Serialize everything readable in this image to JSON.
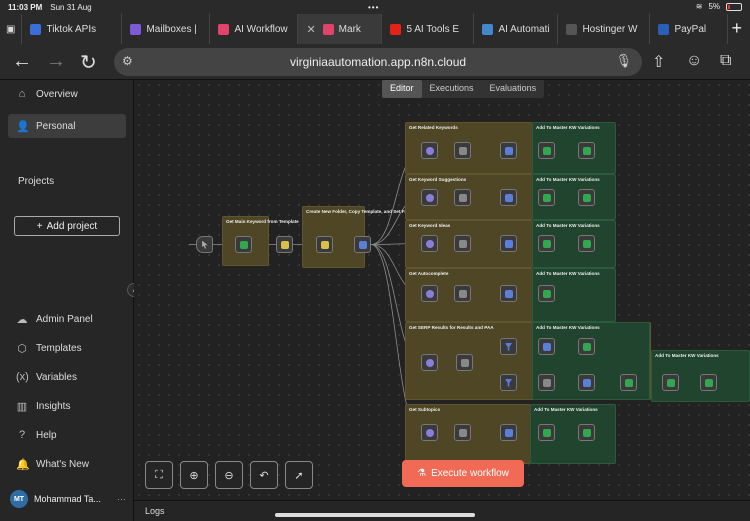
{
  "status": {
    "time": "11:03 PM",
    "date": "Sun 31 Aug",
    "battery": "5%"
  },
  "tabs": [
    {
      "label": "Tiktok APIs",
      "color": "#3b6ed8",
      "icon": "globe-icon"
    },
    {
      "label": "Mailboxes | ",
      "color": "#7b5bd6",
      "icon": "mailbox-icon"
    },
    {
      "label": "AI Workflow",
      "color": "#e1436b",
      "icon": "n8n-icon"
    },
    {
      "label": "Mark",
      "color": "#e1436b",
      "icon": "n8n-icon",
      "active": true
    },
    {
      "label": "5 AI Tools E",
      "color": "#e62117",
      "icon": "youtube-icon"
    },
    {
      "label": "AI Automati",
      "color": "#4488cc",
      "icon": "wave-icon"
    },
    {
      "label": "Hostinger W",
      "color": "#555555",
      "icon": "hostinger-icon"
    },
    {
      "label": "PayPal",
      "color": "#2a5fb8",
      "icon": "paypal-icon"
    }
  ],
  "address": {
    "url": "virginiaautomation.app.n8n.cloud"
  },
  "sidebar": {
    "top_items": [
      {
        "label": "Overview",
        "icon": "home-icon",
        "glyph": "⌂"
      },
      {
        "label": "Personal",
        "icon": "user-icon",
        "glyph": "👤",
        "active": true
      }
    ],
    "projects_heading": "Projects",
    "add_project": "Add project",
    "bottom_items": [
      {
        "label": "Admin Panel",
        "icon": "cloud-icon",
        "glyph": "☁"
      },
      {
        "label": "Templates",
        "icon": "box-icon",
        "glyph": "⬡"
      },
      {
        "label": "Variables",
        "icon": "variable-icon",
        "glyph": "(x)"
      },
      {
        "label": "Insights",
        "icon": "chart-icon",
        "glyph": "▥"
      },
      {
        "label": "Help",
        "icon": "help-icon",
        "glyph": "?"
      },
      {
        "label": "What's New",
        "icon": "bell-icon",
        "glyph": "🔔"
      }
    ],
    "user": {
      "name": "Mohammad Ta...",
      "initials": "MT"
    }
  },
  "view_tabs": [
    "Editor",
    "Executions",
    "Evaluations"
  ],
  "notes": [
    {
      "title": "Get Main Keyword from Template",
      "color": "yellow"
    },
    {
      "title": "Create New Folder, Copy Template, and Set Fields",
      "color": "yellow"
    },
    {
      "title": "Get Related Keywords",
      "color": "yellow"
    },
    {
      "title": "Get Keyword Suggestions",
      "color": "yellow"
    },
    {
      "title": "Get Keyword Ideas",
      "color": "yellow"
    },
    {
      "title": "Get Autocomplete",
      "color": "yellow"
    },
    {
      "title": "Get SERP Results for Results and PAA",
      "color": "yellow"
    },
    {
      "title": "Get Subtopics",
      "color": "yellow"
    },
    {
      "title": "Add To Master KW Variations",
      "color": "green"
    },
    {
      "title": "Add To Master KW Variations",
      "color": "green"
    },
    {
      "title": "Add To Master KW Variations",
      "color": "green"
    },
    {
      "title": "Add To Master KW Variations",
      "color": "green"
    },
    {
      "title": "Add To Master KW Variations",
      "color": "green"
    },
    {
      "title": "Add To Master KW Variations",
      "color": "green"
    },
    {
      "title": "Add To Master KW Variations",
      "color": "green"
    }
  ],
  "toolbar": [
    "fit-view-icon",
    "zoom-in-icon",
    "zoom-out-icon",
    "undo-icon",
    "pointer-icon"
  ],
  "execute_label": "Execute workflow",
  "logs_label": "Logs",
  "accent": "#f06a55"
}
